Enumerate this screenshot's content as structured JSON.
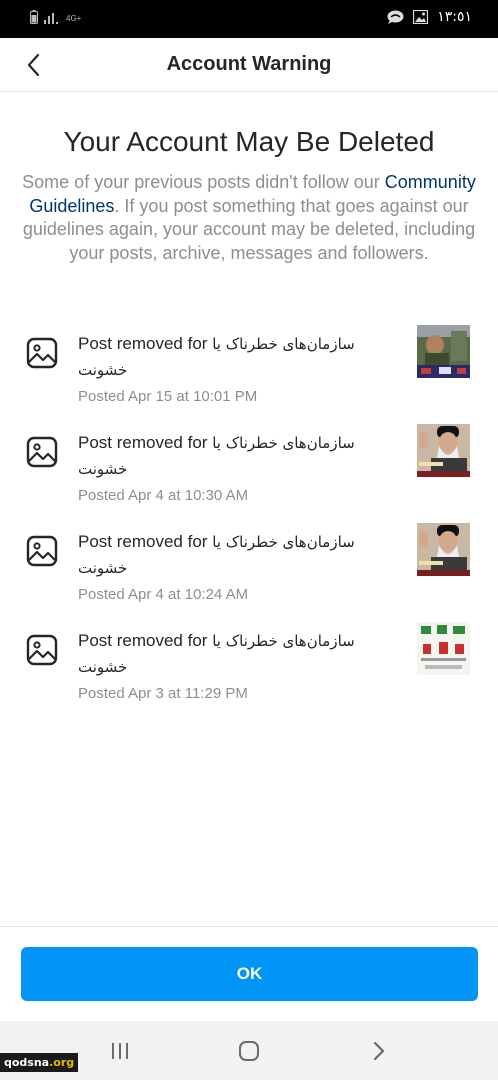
{
  "status_bar": {
    "network": "4G+",
    "clock": "١٣:٥١"
  },
  "header": {
    "title": "Account Warning",
    "back_icon": "chevron-left-icon"
  },
  "warning": {
    "title": "Your Account May Be Deleted",
    "body_prefix": "Some of your previous posts didn't follow our",
    "link_text": "Community Guidelines",
    "body_suffix": ". If you post something that goes against our guidelines again, your account may be deleted, including your posts, archive, messages and followers."
  },
  "posts": [
    {
      "prefix": "Post removed for",
      "reason": "سازمان‌های خطرناک یا خشونت",
      "time": "Posted Apr 15 at 10:01 PM"
    },
    {
      "prefix": "Post removed for",
      "reason": "سازمان‌های خطرناک یا خشونت",
      "time": "Posted Apr 4 at 10:30 AM"
    },
    {
      "prefix": "Post removed for",
      "reason": "سازمان‌های خطرناک یا خشونت",
      "time": "Posted Apr 4 at 10:24 AM"
    },
    {
      "prefix": "Post removed for",
      "reason": "سازمان‌های خطرناک یا خشونت",
      "time": "Posted Apr 3 at 11:29 PM"
    }
  ],
  "ok_button": {
    "label": "OK"
  },
  "watermark": {
    "name": "qodsna",
    "tld": ".org"
  },
  "colors": {
    "accent": "#0095f6",
    "link": "#00376b",
    "secondary_text": "#8e8e8e",
    "primary_text": "#262626"
  }
}
